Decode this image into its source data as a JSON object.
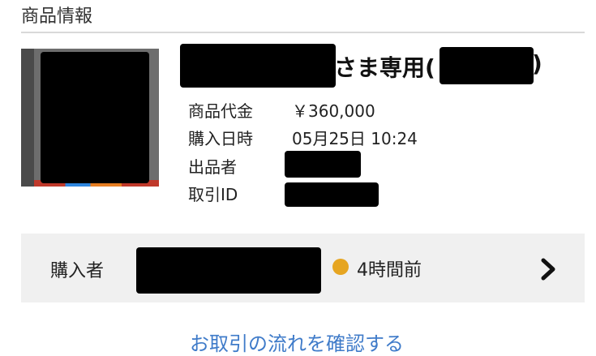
{
  "section": {
    "title": "商品情報"
  },
  "item": {
    "title_suffix": "さま専用(",
    "title_close": ")",
    "price_label": "商品代金",
    "price_value": "￥360,000",
    "date_label": "購入日時",
    "date_value": "05月25日 10:24",
    "seller_label": "出品者",
    "tx_label": "取引ID"
  },
  "buyer": {
    "label": "購入者",
    "status_text": "4時間前",
    "status_color": "#e6a521"
  },
  "footer": {
    "link_text": "お取引の流れを確認する"
  },
  "icons": {
    "arrow": "chevron-right-icon"
  }
}
